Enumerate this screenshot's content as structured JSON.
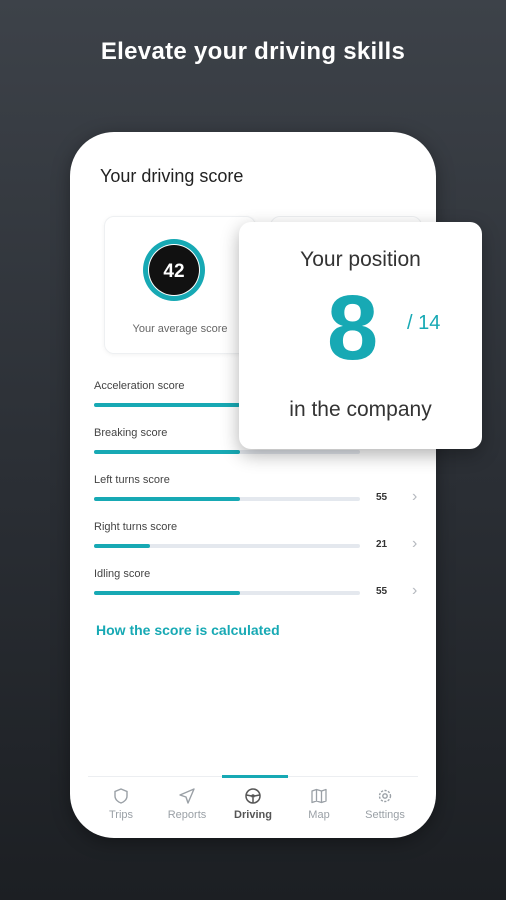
{
  "headline": "Elevate your driving skills",
  "screen": {
    "title": "Your driving score",
    "average": {
      "value": "42",
      "label": "Your average score",
      "fraction": 0.42
    },
    "scores": [
      {
        "label": "Acceleration score",
        "value": "",
        "fraction": 0.55
      },
      {
        "label": "Breaking score",
        "value": "",
        "fraction": 0.55
      },
      {
        "label": "Left turns score",
        "value": "55",
        "fraction": 0.55
      },
      {
        "label": "Right turns score",
        "value": "21",
        "fraction": 0.21
      },
      {
        "label": "Idling score",
        "value": "55",
        "fraction": 0.55
      }
    ],
    "link": "How the score is calculated"
  },
  "position_card": {
    "title": "Your position",
    "position": "8",
    "total": "/ 14",
    "subtitle": "in the company"
  },
  "nav": {
    "items": [
      {
        "label": "Trips",
        "icon": "shield-icon"
      },
      {
        "label": "Reports",
        "icon": "send-icon"
      },
      {
        "label": "Driving",
        "icon": "steering-wheel-icon",
        "active": true
      },
      {
        "label": "Map",
        "icon": "map-icon"
      },
      {
        "label": "Settings",
        "icon": "gear-icon"
      }
    ]
  },
  "colors": {
    "accent": "#17a9b4",
    "dark": "#1c1f23"
  }
}
